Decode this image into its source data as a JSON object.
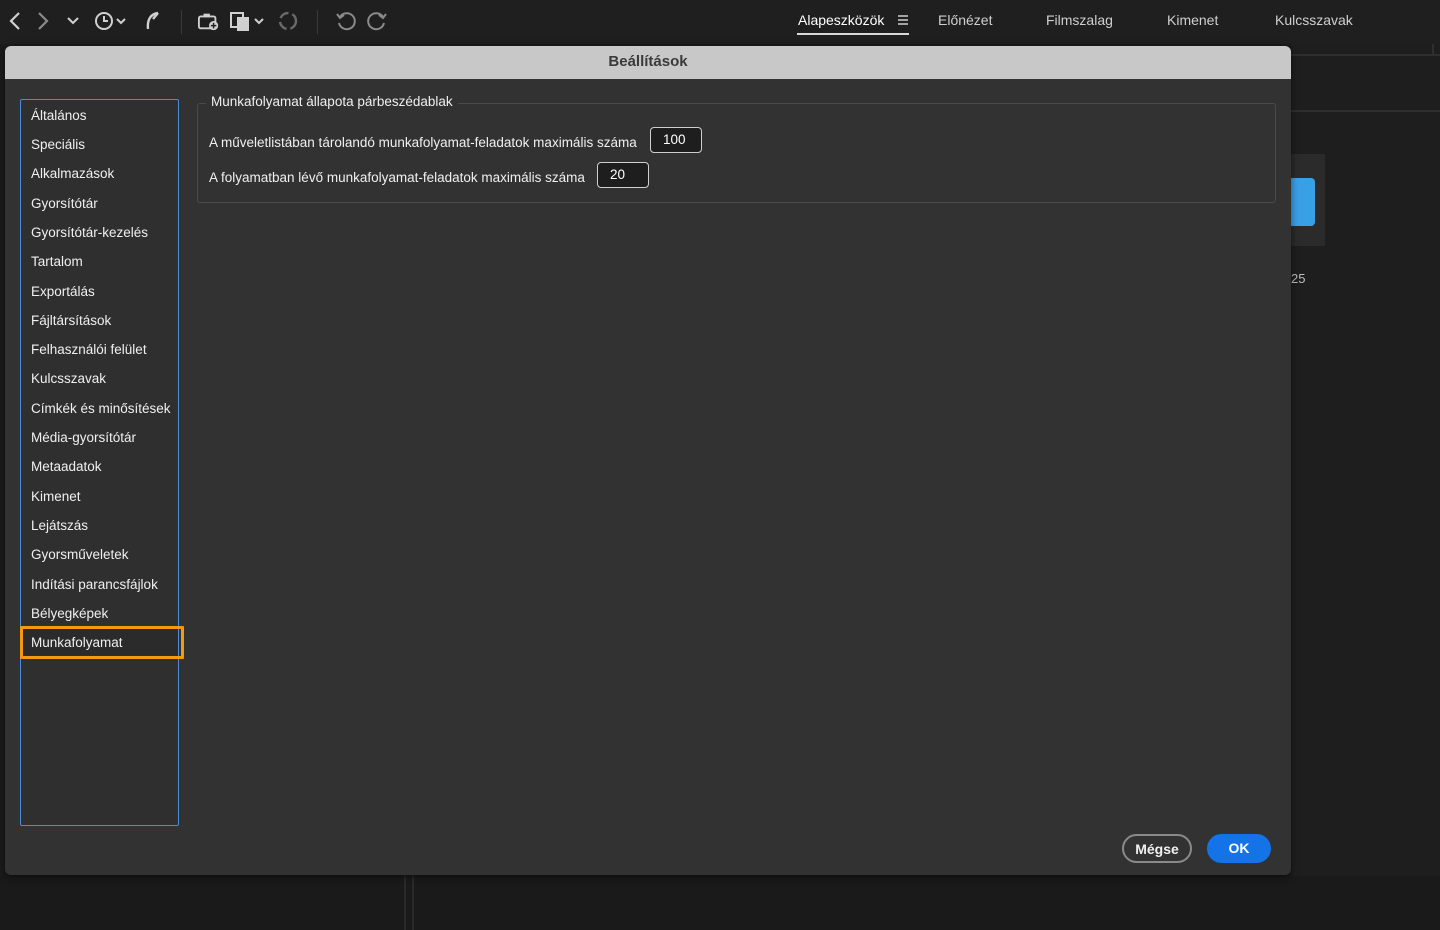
{
  "topbar": {
    "icons": [
      "back-icon",
      "forward-icon",
      "chevron-down-icon",
      "history-icon",
      "boomerang-icon",
      "camera-import-icon",
      "copy-icon",
      "refine-icon",
      "rotate-left-icon",
      "rotate-right-icon"
    ],
    "workspaces": [
      {
        "label": "Alapeszközök",
        "active": true
      },
      {
        "label": "Előnézet",
        "active": false
      },
      {
        "label": "Filmszalag",
        "active": false
      },
      {
        "label": "Kimenet",
        "active": false
      },
      {
        "label": "Kulcsszavak",
        "active": false
      }
    ]
  },
  "background": {
    "partial_text": "25"
  },
  "dialog": {
    "title": "Beállítások",
    "categories": [
      "Általános",
      "Speciális",
      "Alkalmazások",
      "Gyorsítótár",
      "Gyorsítótár-kezelés",
      "Tartalom",
      "Exportálás",
      "Fájltársítások",
      "Felhasználói felület",
      "Kulcsszavak",
      "Címkék és minősítések",
      "Média-gyorsítótár",
      "Metaadatok",
      "Kimenet",
      "Lejátszás",
      "Gyorsműveletek",
      "Indítási parancsfájlok",
      "Bélyegképek",
      "Munkafolyamat"
    ],
    "selected_category": "Munkafolyamat",
    "group": {
      "title": "Munkafolyamat állapota párbeszédablak",
      "fields": [
        {
          "label": "A műveletlistában tárolandó munkafolyamat-feladatok maximális száma",
          "value": "100"
        },
        {
          "label": "A folyamatban lévő munkafolyamat-feladatok maximális száma",
          "value": "20"
        }
      ]
    },
    "buttons": {
      "cancel": "Mégse",
      "ok": "OK"
    }
  },
  "colors": {
    "accent": "#1473e6",
    "highlight": "#f39a12",
    "list_border": "#4a8cd6"
  }
}
